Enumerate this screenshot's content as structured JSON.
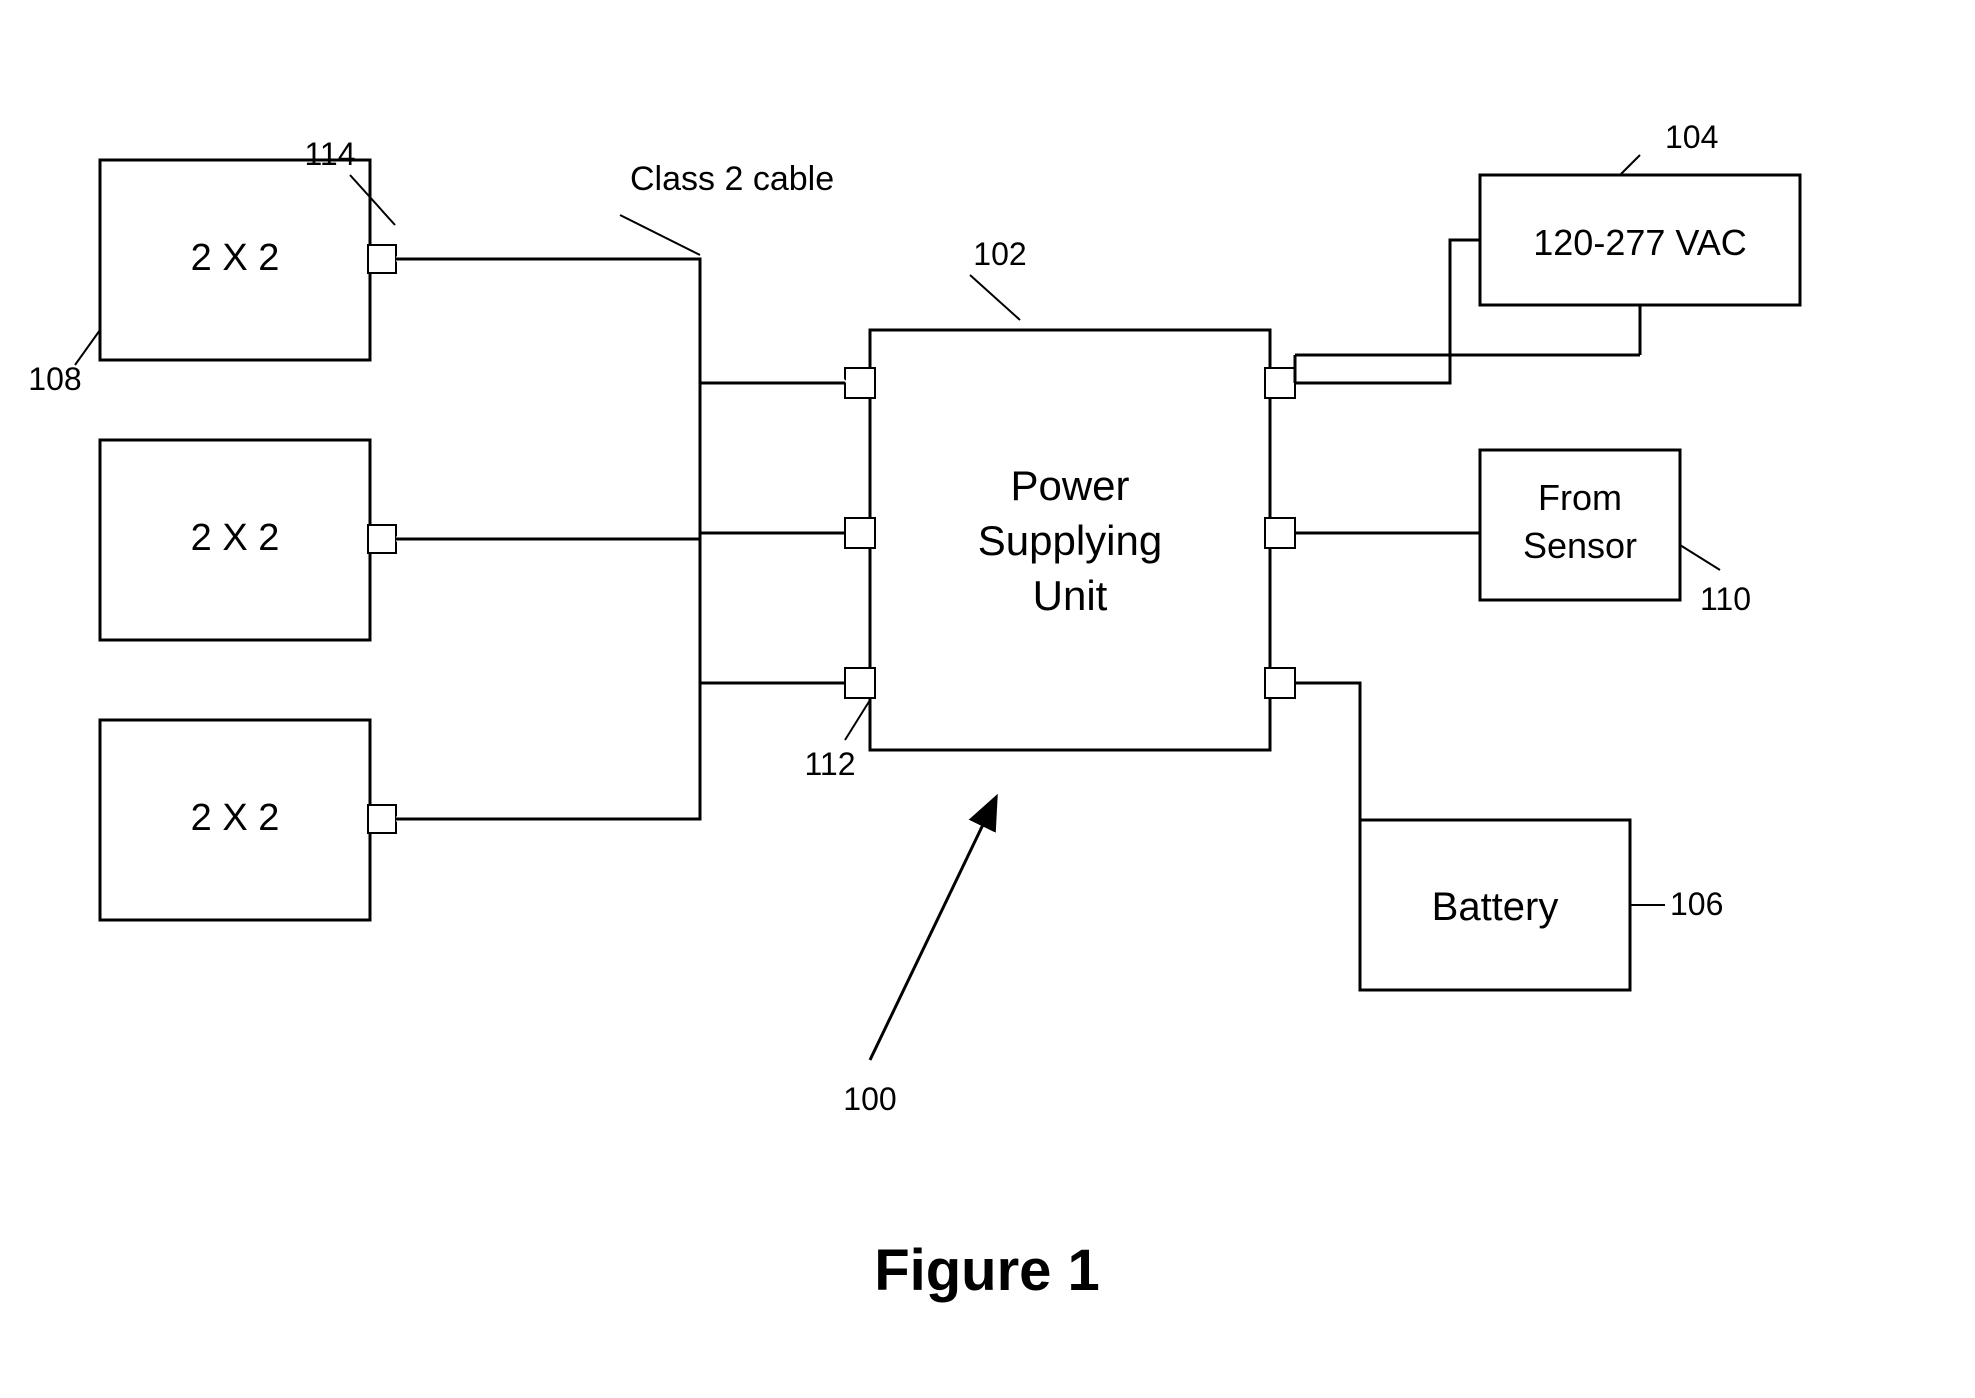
{
  "title": "Figure 1",
  "figure_label": "Figure 1",
  "nodes": {
    "psu": {
      "label_line1": "Power",
      "label_line2": "Supplying Unit",
      "ref": "102"
    },
    "vac": {
      "label": "120-277 VAC",
      "ref": "104"
    },
    "sensor": {
      "label_line1": "From",
      "label_line2": "Sensor",
      "ref": "110"
    },
    "battery": {
      "label": "Battery",
      "ref": "106"
    },
    "fixture1": {
      "label": "2 X 2",
      "ref": "108"
    },
    "fixture2": {
      "label": "2 X 2",
      "ref": ""
    },
    "fixture3": {
      "label": "2 X 2",
      "ref": ""
    }
  },
  "labels": {
    "class2cable": "Class 2 cable",
    "ref_100": "100",
    "ref_102": "102",
    "ref_104": "104",
    "ref_106": "106",
    "ref_108": "108",
    "ref_110": "110",
    "ref_112": "112",
    "ref_114": "114"
  }
}
